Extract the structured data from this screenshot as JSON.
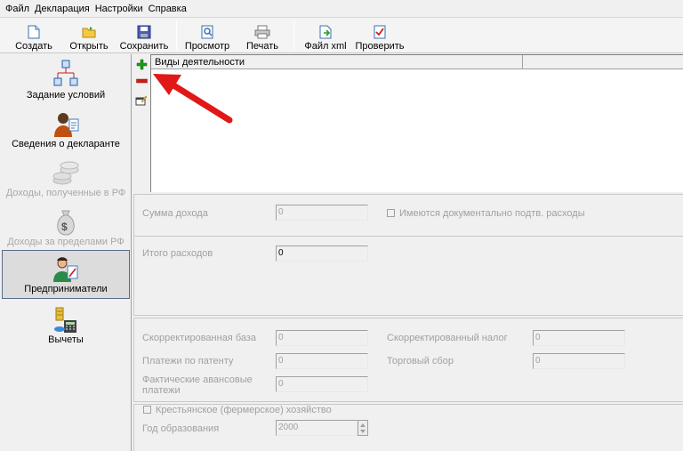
{
  "menu": [
    "Файл",
    "Декларация",
    "Настройки",
    "Справка"
  ],
  "toolbar": {
    "create": "Создать",
    "open": "Открыть",
    "save": "Сохранить",
    "preview": "Просмотр",
    "print": "Печать",
    "xml": "Файл xml",
    "check": "Проверить"
  },
  "nav": [
    {
      "label": "Задание условий",
      "icon": "conditions-icon",
      "state": "normal"
    },
    {
      "label": "Сведения о декларанте",
      "icon": "declarant-icon",
      "state": "normal"
    },
    {
      "label": "Доходы, полученные в РФ",
      "icon": "income-rf-icon",
      "state": "disabled"
    },
    {
      "label": "Доходы за пределами РФ",
      "icon": "money-bag-icon",
      "state": "disabled"
    },
    {
      "label": "Предприниматели",
      "icon": "entrepreneur-icon",
      "state": "selected"
    },
    {
      "label": "Вычеты",
      "icon": "deductions-icon",
      "state": "normal"
    }
  ],
  "grid": {
    "column": "Виды деятельности"
  },
  "form": {
    "income_label": "Сумма дохода",
    "income_value": "0",
    "documented_expenses_label": "Имеются документально подтв. расходы",
    "total_expenses_label": "Итого расходов",
    "total_expenses_value": "0",
    "adjusted_base_label": "Скорректированная база",
    "adjusted_base_value": "0",
    "adjusted_tax_label": "Скорректированный налог",
    "adjusted_tax_value": "0",
    "patent_payments_label": "Платежи по патенту",
    "patent_payments_value": "0",
    "trade_fee_label": "Торговый сбор",
    "trade_fee_value": "0",
    "advance_payments_label_1": "Фактические авансовые",
    "advance_payments_label_2": "платежи",
    "advance_payments_value": "0",
    "farm_label": "Крестьянское (фермерское) хозяйство",
    "year_label": "Год образования",
    "year_value": "2000"
  },
  "colors": {
    "add": "#1a9a1a",
    "remove": "#d01a1a",
    "arrow": "#e01818",
    "selected_border": "#5a6a8a"
  }
}
